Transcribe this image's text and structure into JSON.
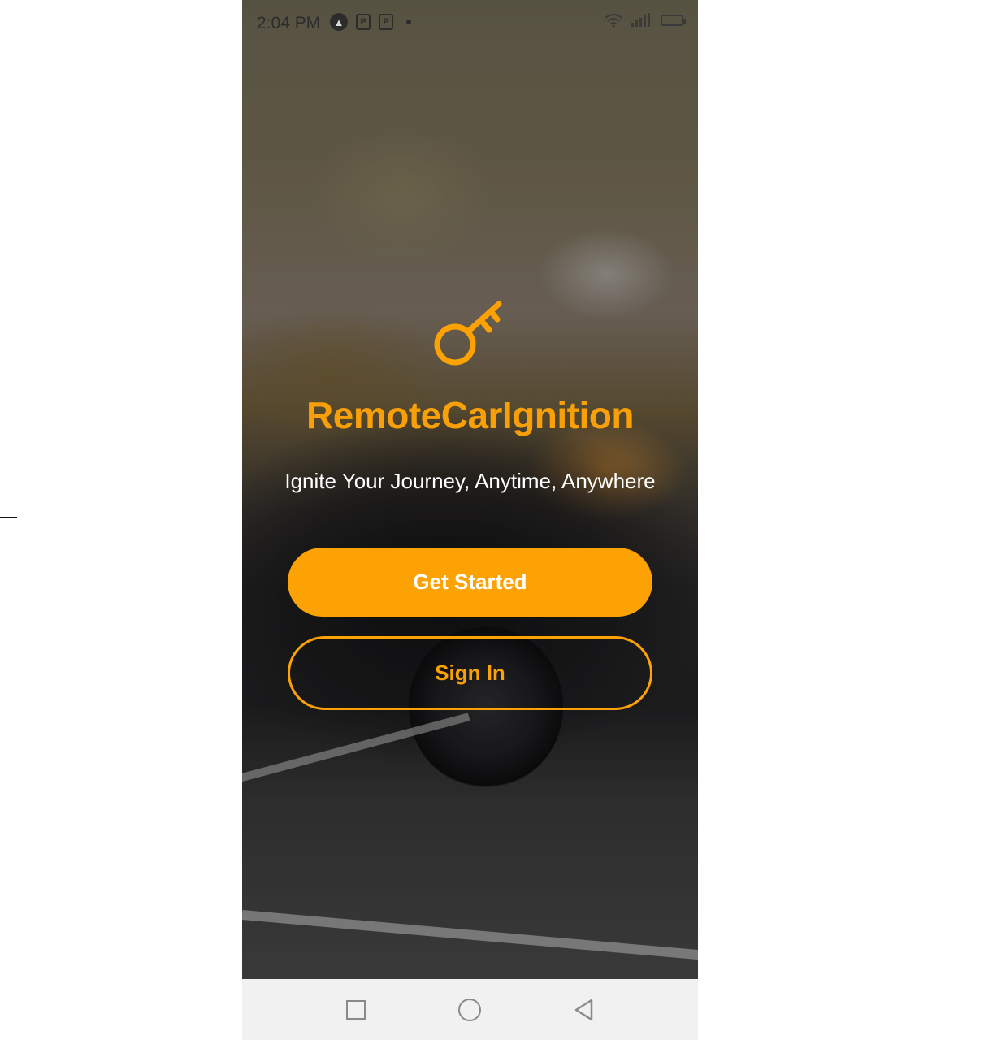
{
  "status_bar": {
    "time": "2:04 PM",
    "left_icons": [
      "app-notification-icon",
      "parking-icon",
      "parking-icon",
      "dot-icon"
    ],
    "right_icons": [
      "wifi-icon",
      "signal-icon",
      "battery-icon"
    ]
  },
  "hero": {
    "icon": "key-icon",
    "title": "RemoteCarIgnition",
    "tagline": "Ignite Your Journey, Anytime, Anywhere"
  },
  "actions": {
    "get_started_label": "Get Started",
    "sign_in_label": "Sign In"
  },
  "nav_bar": {
    "buttons": [
      "recents-icon",
      "home-icon",
      "back-icon"
    ]
  },
  "colors": {
    "accent": "#fca205",
    "title": "#f9a008",
    "tagline": "#ffffff",
    "nav_background": "#f1f1f1"
  }
}
